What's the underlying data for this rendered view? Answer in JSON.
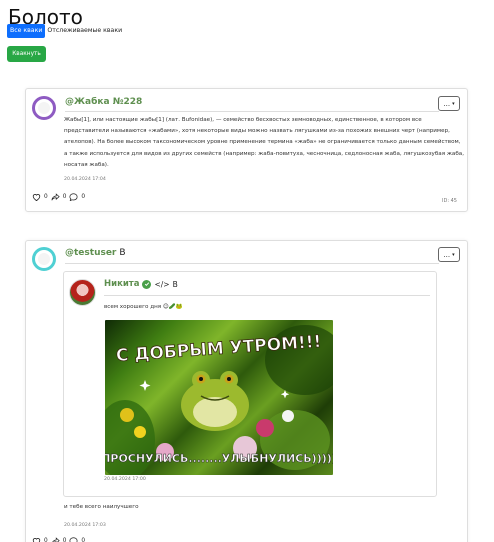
{
  "page": {
    "title": "Болото"
  },
  "tabs": {
    "all": "Все кваки",
    "following": "Отслеживаемые кваки"
  },
  "actions": {
    "kvaknut": "Квакнуть"
  },
  "posts": [
    {
      "username": "@Жабка №228",
      "dropdown": "...",
      "text": "Жабы[1], или настоящие жабы[1] (лат. Bufonidae), — семейство бесхвостых земноводных, единственное, в котором все представители называются «жабами», хотя некоторые виды можно назвать лягушками из-за похожих внешних черт (например, ателопов). На более высоком таксономическом уровне применение термина «жаба» не ограничивается только данным семейством, а также используется для видов из других семейств (например: жаба-повитуха, чесночница, седлоносная жаба, лягушкозубая жаба, носатая жаба).",
      "timestamp": "20.04.2024 17:04",
      "likes": "0",
      "reposts": "0",
      "comments": "0",
      "id_label": "ID: 45",
      "avatar_color": "#8e5bc2"
    },
    {
      "username": "@testuser",
      "badge": "B",
      "dropdown": "...",
      "repost": {
        "author": "Никита",
        "code_badge": "</>",
        "badge": "B",
        "text": "всем хорошего дня 😊🥒🐸",
        "timestamp": "20.04.2024 17:00",
        "image_caption_top": "С ДОБРЫМ УТРОМ!!!",
        "image_caption_bottom": "ПРОСНУЛИСЬ........УЛЫБНУЛИСЬ)))))"
      },
      "text": "и тебе всего наилучшего",
      "timestamp": "20.04.2024 17:03",
      "likes": "0",
      "reposts": "0",
      "comments": "0",
      "avatar_color": "#4fd0d3"
    }
  ],
  "colors": {
    "primary": "#0d6efd",
    "success": "#28a745",
    "username": "#5e8f4f"
  },
  "icons": {
    "like": "heart-icon",
    "repost": "share-arrow-icon",
    "comment": "speech-bubble-icon",
    "verified": "verified-check-icon",
    "code": "code-icon",
    "caret": "caret-down-icon"
  }
}
